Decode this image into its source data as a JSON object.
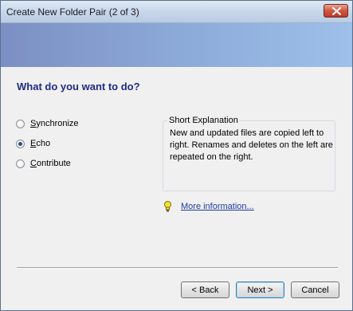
{
  "window": {
    "title": "Create New Folder Pair (2 of 3)"
  },
  "main": {
    "heading": "What do you want to do?",
    "options": [
      {
        "mnemonic": "S",
        "rest": "ynchronize",
        "checked": false
      },
      {
        "mnemonic": "E",
        "rest": "cho",
        "checked": true
      },
      {
        "mnemonic": "C",
        "rest": "ontribute",
        "checked": false
      }
    ],
    "explanation": {
      "title": "Short Explanation",
      "text": "New and updated files are copied left to right. Renames and deletes on the left are repeated on the right."
    },
    "more_info_link": "More information...",
    "more_info_icon": "lightbulb-icon"
  },
  "footer": {
    "back_label": "< Back",
    "next_label": "Next >",
    "cancel_label": "Cancel"
  },
  "colors": {
    "heading": "#1d2c86",
    "link": "#1f3aa0",
    "banner_start": "#7c8fc4",
    "banner_end": "#9ec0ea"
  }
}
